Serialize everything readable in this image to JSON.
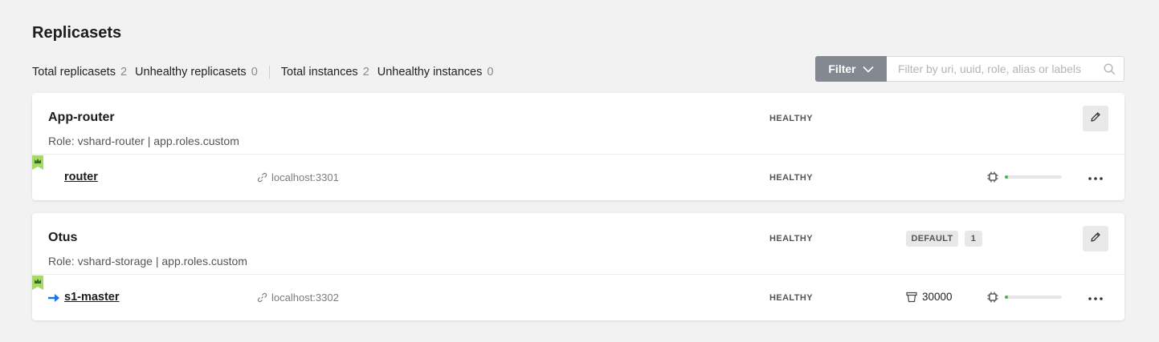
{
  "page": {
    "title": "Replicasets"
  },
  "stats": [
    {
      "label": "Total replicasets",
      "value": "2"
    },
    {
      "label": "Unhealthy replicasets",
      "value": "0"
    },
    {
      "label": "Total instances",
      "value": "2"
    },
    {
      "label": "Unhealthy instances",
      "value": "0"
    }
  ],
  "filter": {
    "button_label": "Filter",
    "placeholder": "Filter by uri, uuid, role, alias or labels",
    "value": ""
  },
  "replicasets": [
    {
      "name": "App-router",
      "role": "Role: vshard-router | app.roles.custom",
      "status": "HEALTHY",
      "instances": [
        {
          "name": "router",
          "uri": "localhost:3301",
          "status": "HEALTHY",
          "leader": true,
          "memory_usage": 0.05
        }
      ]
    },
    {
      "name": "Otus",
      "role": "Role: vshard-storage | app.roles.custom",
      "status": "HEALTHY",
      "vshard_group": "DEFAULT",
      "weight": "1",
      "instances": [
        {
          "name": "s1-master",
          "uri": "localhost:3302",
          "status": "HEALTHY",
          "leader": true,
          "master": true,
          "buckets": "30000",
          "memory_usage": 0.05
        }
      ]
    }
  ],
  "colors": {
    "leader_badge": "#a6d96a",
    "master_arrow": "#1a73e8",
    "memory_fill": "#4db34d",
    "filter_button": "#838891"
  },
  "icons": {
    "leader": "crown-icon",
    "uri": "link-icon",
    "buckets": "bucket-icon",
    "memory": "chip-icon",
    "edit": "pencil-icon",
    "more": "ellipsis-icon",
    "search": "search-icon",
    "filter_toggle": "chevron-down-icon",
    "master": "arrow-right-icon"
  }
}
